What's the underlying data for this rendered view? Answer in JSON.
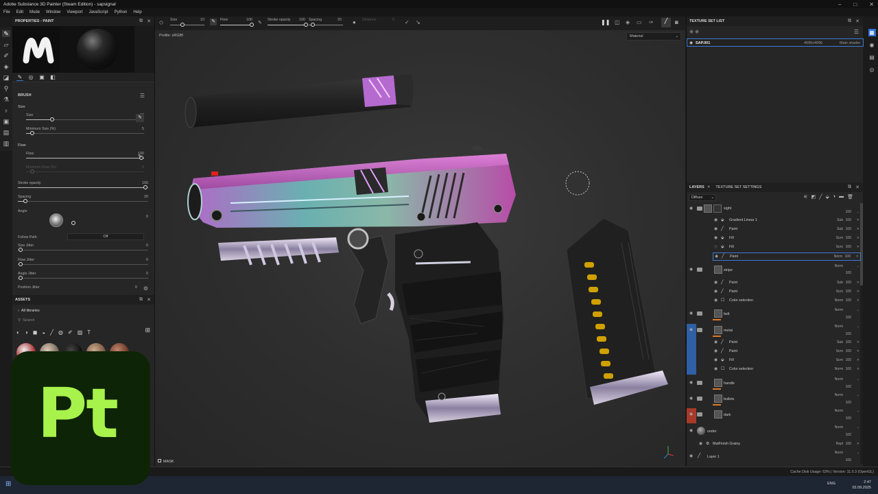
{
  "window": {
    "title": "Adobe Substance 3D Painter (Steam Edition) - sapsignal",
    "controls": [
      "–",
      "□",
      "✕"
    ]
  },
  "menu": [
    "File",
    "Edit",
    "Mode",
    "Window",
    "Viewport",
    "JavaScript",
    "Python",
    "Help"
  ],
  "properties": {
    "title": "PROPERTIES - PAINT",
    "section": "BRUSH",
    "size_group": "Size",
    "size_label": "Size",
    "size_value": "10",
    "min_size_label": "Minimum Size (%)",
    "min_size_value": "5",
    "flow_group": "Flow",
    "flow_label": "Flow",
    "flow_value": "100",
    "min_flow_label": "Minimum Flow (%)",
    "min_flow_value": "0",
    "stroke_opacity_label": "Stroke opacity",
    "stroke_opacity_value": "100",
    "spacing_label": "Spacing",
    "spacing_value": "20",
    "angle_label": "Angle",
    "angle_value": "0",
    "follow_path_label": "Follow Path",
    "follow_path_value": "Off",
    "size_jitter_label": "Size Jitter",
    "size_jitter_value": "0",
    "flow_jitter_label": "Flow Jitter",
    "flow_jitter_value": "0",
    "angle_jitter_label": "Angle Jitter",
    "angle_jitter_value": "0",
    "position_jitter_label": "Position Jitter",
    "position_jitter_value": "0"
  },
  "assets": {
    "title": "ASSETS",
    "library": "All libraries",
    "search_placeholder": "Search"
  },
  "viewport_toolbar": {
    "size_label": "Size",
    "size_value": "10",
    "flow_label": "Flow",
    "flow_value": "100",
    "stroke_opacity_label": "Stroke opacity",
    "stroke_opacity_value": "100",
    "spacing_label": "Spacing",
    "spacing_value": "20",
    "distance_label": "Distance",
    "distance_value": "0"
  },
  "viewport": {
    "profile": "Profile: sRGBf",
    "material_mode": "Material",
    "mask_label": "MASK"
  },
  "texture_set_list": {
    "title": "TEXTURE SET LIST",
    "item_name": "SAP.001",
    "item_res": "4096x4096",
    "item_shader": "Main shader"
  },
  "layers_panel": {
    "tab_layers": "LAYERS",
    "tab_texture_settings": "TEXTURE SET SETTINGS",
    "channel": "Diffuse",
    "layers": [
      {
        "name": "sight",
        "blend": "",
        "opacity": "100",
        "type": "folder"
      },
      {
        "name": "Gradient Linear 1",
        "blend": "Sub",
        "opacity": "100",
        "type": "effect"
      },
      {
        "name": "Paint",
        "blend": "Sub",
        "opacity": "100",
        "type": "effect"
      },
      {
        "name": "Fill",
        "blend": "Scrn",
        "opacity": "100",
        "type": "effect"
      },
      {
        "name": "Fill",
        "blend": "Scrn",
        "opacity": "100",
        "type": "effect"
      },
      {
        "name": "Paint",
        "blend": "Norm",
        "opacity": "100",
        "type": "effect-selected"
      },
      {
        "name": "stripe",
        "blend": "Norm",
        "opacity": "100",
        "type": "folder"
      },
      {
        "name": "Paint",
        "blend": "Sub",
        "opacity": "100",
        "type": "effect"
      },
      {
        "name": "Paint",
        "blend": "Scrn",
        "opacity": "100",
        "type": "effect"
      },
      {
        "name": "Color selection",
        "blend": "Norm",
        "opacity": "100",
        "type": "effect"
      },
      {
        "name": "belt",
        "blend": "Norm",
        "opacity": "100",
        "type": "folder"
      },
      {
        "name": "metal",
        "blend": "Norm",
        "opacity": "100",
        "type": "folder"
      },
      {
        "name": "Paint",
        "blend": "Sub",
        "opacity": "100",
        "type": "effect"
      },
      {
        "name": "Paint",
        "blend": "Scrn",
        "opacity": "100",
        "type": "effect"
      },
      {
        "name": "Fill",
        "blend": "Scrn",
        "opacity": "100",
        "type": "effect"
      },
      {
        "name": "Color selection",
        "blend": "Norm",
        "opacity": "100",
        "type": "effect"
      },
      {
        "name": "handle",
        "blend": "Norm",
        "opacity": "100",
        "type": "folder"
      },
      {
        "name": "bullets",
        "blend": "Norm",
        "opacity": "100",
        "type": "folder"
      },
      {
        "name": "dark",
        "blend": "Norm",
        "opacity": "100",
        "type": "folder"
      },
      {
        "name": "under",
        "blend": "Norm",
        "opacity": "100",
        "type": "layer"
      },
      {
        "name": "MatFinish Grainy",
        "blend": "Repl",
        "opacity": "100",
        "type": "effect"
      },
      {
        "name": "Layer 1",
        "blend": "Norm",
        "opacity": "100",
        "type": "layer"
      }
    ]
  },
  "status": {
    "text": "Cache Disk Usage:   63% | Version: 11.0.3 (OpenGL)"
  },
  "taskbar": {
    "lang": "ENG",
    "time": "2:47",
    "date": "02.09.2025"
  },
  "logo": {
    "text": "Pt"
  }
}
